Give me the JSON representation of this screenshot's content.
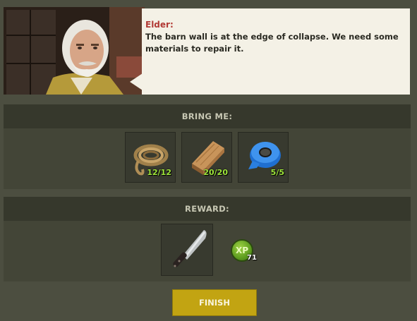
{
  "dialog": {
    "speaker": "Elder:",
    "text": "The barn wall is at the edge of collapse. We need some materials to repair it."
  },
  "bring": {
    "header": "BRING ME:",
    "items": [
      {
        "icon": "rope-icon",
        "count": "12/12"
      },
      {
        "icon": "wooden-plank-icon",
        "count": "20/20"
      },
      {
        "icon": "duct-tape-icon",
        "count": "5/5"
      }
    ]
  },
  "reward": {
    "header": "REWARD:",
    "item_icon": "machete-icon",
    "xp_label": "XP",
    "xp_amount": "71"
  },
  "finish_label": "FINISH",
  "colors": {
    "background": "#4c4e40",
    "section_header": "#36382c",
    "count_green": "#9ee53a",
    "speaker_red": "#b23a35",
    "finish_button": "#c2a412",
    "bubble": "#f4f1e6"
  }
}
